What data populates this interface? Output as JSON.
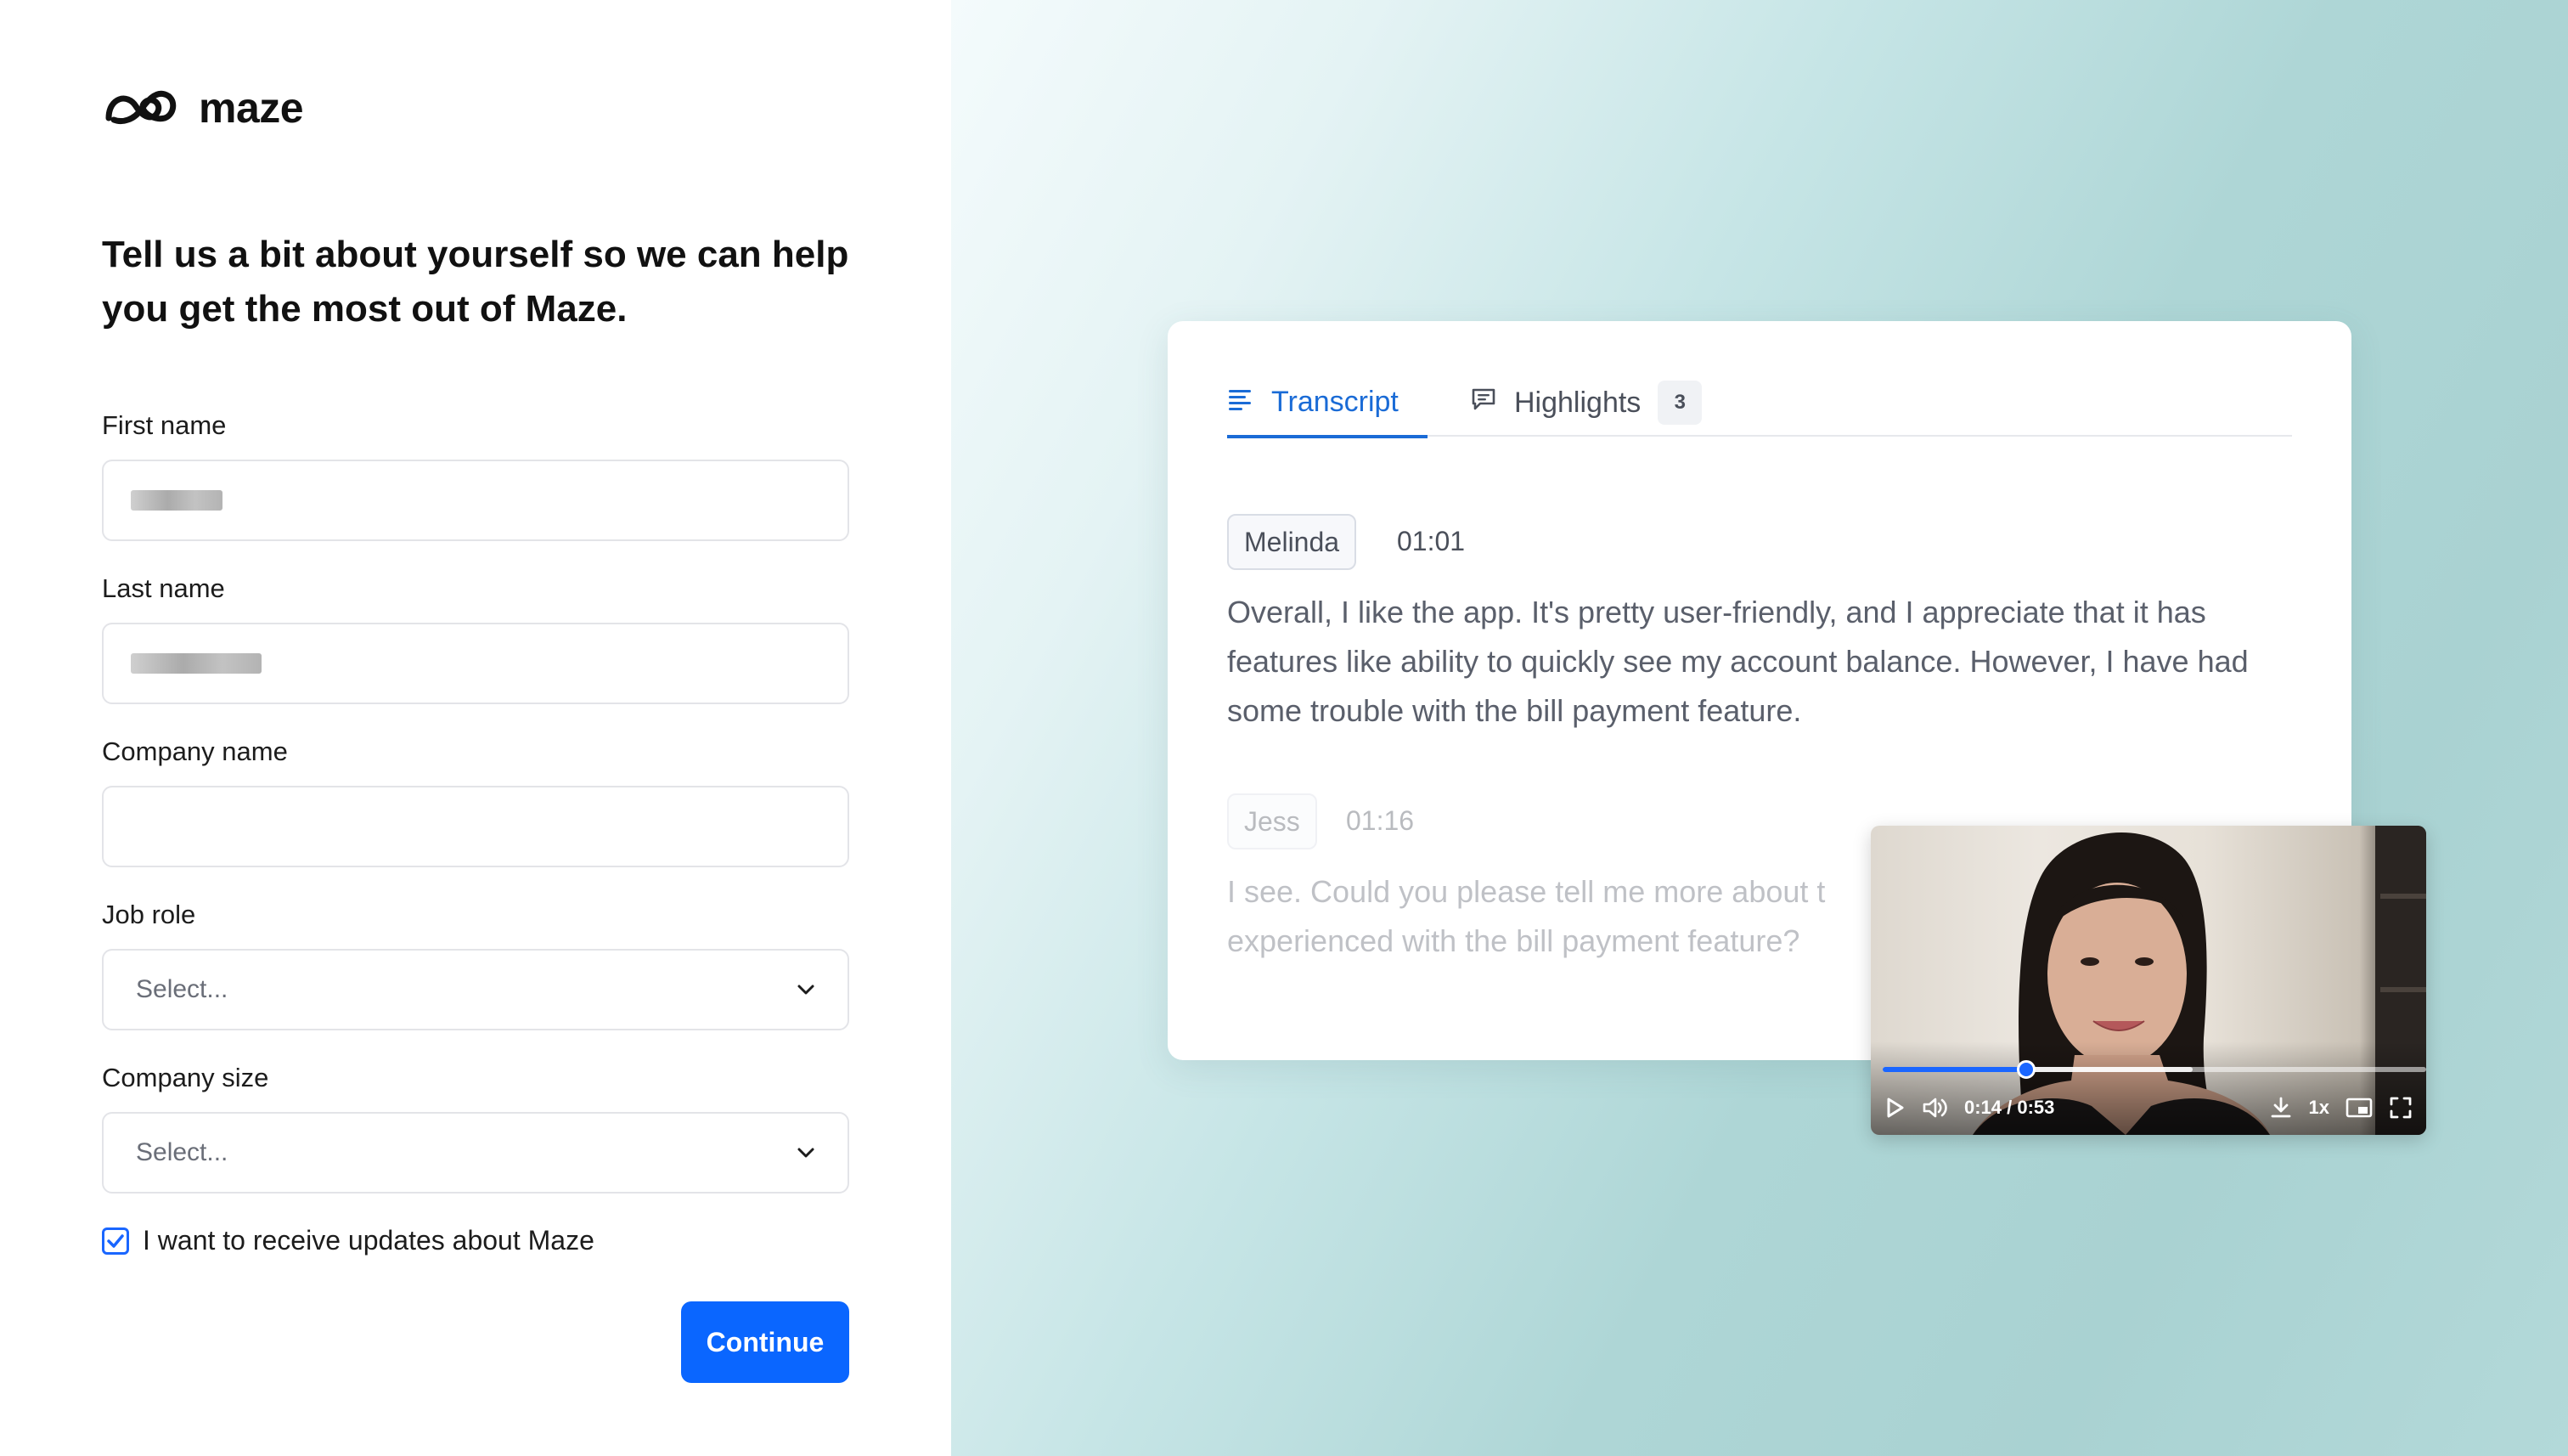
{
  "brand": {
    "name": "maze",
    "logo_icon": "maze-logo-icon"
  },
  "form": {
    "headline": "Tell us a bit about yourself so we can help you get the most out of Maze.",
    "first_name": {
      "label": "First name",
      "value": ""
    },
    "last_name": {
      "label": "Last name",
      "value": ""
    },
    "company_name": {
      "label": "Company name",
      "value": ""
    },
    "job_role": {
      "label": "Job role",
      "selected": "Select..."
    },
    "company_size": {
      "label": "Company size",
      "selected": "Select..."
    },
    "updates_checkbox": {
      "label": "I want to receive updates about Maze",
      "checked": true
    },
    "continue_label": "Continue",
    "accent_color": "#0a66ff"
  },
  "transcript_card": {
    "tabs": [
      {
        "label": "Transcript",
        "icon": "lines-icon",
        "active": true
      },
      {
        "label": "Highlights",
        "icon": "comment-icon",
        "count": "3",
        "active": false
      }
    ],
    "entries": [
      {
        "speaker": "Melinda",
        "time": "01:01",
        "text": "Overall, I like the app. It's pretty user-friendly, and I appreciate that it has features like ability to quickly see my account balance. However, I have had some trouble with the bill payment feature."
      },
      {
        "speaker": "Jess",
        "time": "01:16",
        "text": "I see. Could you please tell me more about t experienced with the bill payment feature?"
      }
    ]
  },
  "video": {
    "time_readout": "0:14 / 0:53",
    "current_seconds": 14,
    "duration_seconds": 53,
    "buffered_fraction": 0.57,
    "speed": "1x",
    "controls": [
      "play-icon",
      "volume-icon",
      "download-icon",
      "pip-icon",
      "fullscreen-icon"
    ]
  }
}
